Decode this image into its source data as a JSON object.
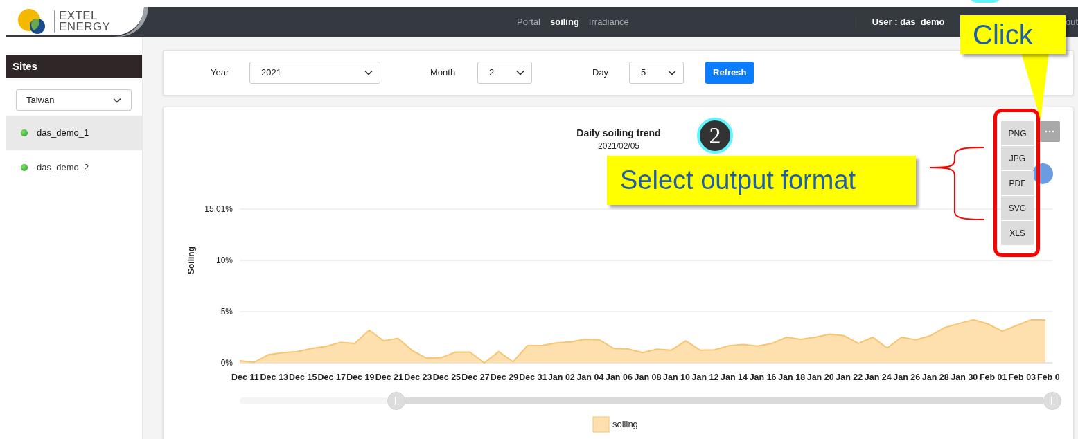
{
  "header": {
    "logo_lines": [
      "EXTEL",
      "ENERGY"
    ],
    "nav": [
      {
        "label": "Portal",
        "selected": false
      },
      {
        "label": "soiling",
        "selected": true
      },
      {
        "label": "Irradiance",
        "selected": false
      }
    ],
    "user": "User : das_demo",
    "logout_partial": "out"
  },
  "sidebar": {
    "title": "Sites",
    "region_select": "Taiwan",
    "sites": [
      {
        "name": "das_demo_1",
        "selected": true
      },
      {
        "name": "das_demo_2",
        "selected": false
      }
    ]
  },
  "filters": {
    "fields": [
      {
        "label": "Year",
        "value": "2021"
      },
      {
        "label": "Month",
        "value": "2"
      },
      {
        "label": "Day",
        "value": "5"
      }
    ],
    "refresh_button": "Refresh"
  },
  "chart_card": {
    "subtitle": "2021/02/05",
    "chart_data": {
      "type": "area",
      "title": "Daily soiling trend",
      "ylabel": "Soiling",
      "categories": [
        "Dec 11",
        null,
        "Dec 13",
        null,
        "Dec 15",
        null,
        "Dec 17",
        null,
        "Dec 19",
        null,
        "Dec 21",
        null,
        "Dec 23",
        null,
        "Dec 25",
        null,
        "Dec 27",
        null,
        "Dec 29",
        null,
        "Dec 31",
        null,
        "Jan 02",
        null,
        "Jan 04",
        null,
        "Jan 06",
        null,
        "Jan 08",
        null,
        "Jan 10",
        null,
        "Jan 12",
        null,
        "Jan 14",
        null,
        "Jan 16",
        null,
        "Jan 18",
        null,
        "Jan 20",
        null,
        "Jan 22",
        null,
        "Jan 24",
        null,
        "Jan 26",
        null,
        "Jan 28",
        null,
        "Jan 30",
        null,
        "Feb 01",
        null,
        "Feb 03",
        null,
        "Feb 0"
      ],
      "series": [
        {
          "name": "soiling",
          "color": "#f8c471",
          "values": [
            0.2,
            0.05,
            0.8,
            1.0,
            1.1,
            1.4,
            1.6,
            2.0,
            1.9,
            3.2,
            2.15,
            2.4,
            1.2,
            0.45,
            0.5,
            1.05,
            1.05,
            0.0,
            1.1,
            0.1,
            1.7,
            1.7,
            1.95,
            2.05,
            2.3,
            2.25,
            1.4,
            1.35,
            1.0,
            1.33,
            1.24,
            2.15,
            1.24,
            1.27,
            1.67,
            1.8,
            1.64,
            1.9,
            2.5,
            2.3,
            2.5,
            2.8,
            2.65,
            1.9,
            2.5,
            1.45,
            2.5,
            2.25,
            2.65,
            3.45,
            3.85,
            4.2,
            3.8,
            3.1,
            3.65,
            4.2,
            4.2
          ]
        }
      ],
      "ylim": [
        0,
        15.01
      ],
      "yticks": [
        {
          "value": 0,
          "label": "0%"
        },
        {
          "value": 5,
          "label": "5%"
        },
        {
          "value": 10,
          "label": "10%"
        },
        {
          "value": 15.01,
          "label": "15.01%"
        }
      ]
    },
    "export_menu": [
      "PNG",
      "JPG",
      "PDF",
      "SVG",
      "XLS"
    ]
  },
  "annotations": {
    "click_callout": "Click",
    "format_callout": "Select output format",
    "step_badge": "2"
  }
}
